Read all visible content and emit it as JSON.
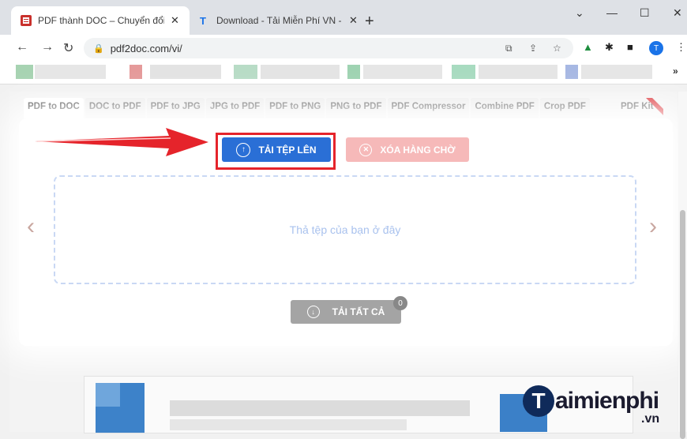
{
  "browser": {
    "tabs": [
      {
        "title": "PDF thành DOC – Chuyển đổi trự",
        "active": true
      },
      {
        "title": "Download - Tải Miễn Phí VN - Ph",
        "active": false
      }
    ],
    "url": "pdf2doc.com/vi/",
    "avatar_letter": "T",
    "more_bookmarks": "»"
  },
  "page": {
    "tool_tabs": [
      "PDF to DOC",
      "DOC to PDF",
      "PDF to JPG",
      "JPG to PDF",
      "PDF to PNG",
      "PNG to PDF",
      "PDF Compressor",
      "Combine PDF",
      "Crop PDF"
    ],
    "active_tool": "PDF to DOC",
    "pdf_kit": "PDF Kit",
    "upload_label": "TẢI TỆP LÊN",
    "clear_label": "XÓA HÀNG CHỜ",
    "dropzone_text": "Thả tệp của bạn ở đây",
    "download_all_label": "TẢI TẤT CẢ",
    "queue_count": "0"
  },
  "watermark": {
    "brand": "aimienphi",
    "initial": "T",
    "tld": ".vn"
  },
  "colors": {
    "upload": "#2a6fd6",
    "clear": "#f6b9b9",
    "highlight": "#e5242b",
    "download_disabled": "#a4a4a4",
    "dropzone_border": "#c9d8f4"
  }
}
